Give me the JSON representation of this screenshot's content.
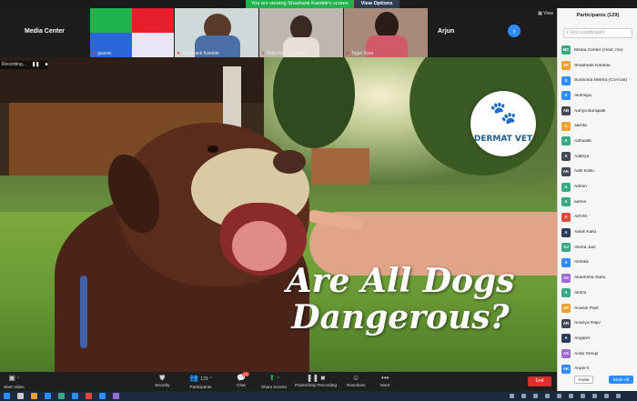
{
  "banner": {
    "message": "You are viewing Shashank Kamble's screen",
    "view_options": "View Options"
  },
  "strip": {
    "center_label": "Media Center",
    "right_label": "Arjun",
    "view_label": "View",
    "thumbs": [
      {
        "name": "gaurav"
      },
      {
        "name": "Shashank Kamble"
      },
      {
        "name": "Ruhi-Precious Pawi"
      },
      {
        "name": "Tejas Vyas"
      }
    ]
  },
  "video": {
    "headline_line1": "Are All Dogs",
    "headline_line2": "Dangerous?",
    "logo_text": "DERMAT VET",
    "rec_status": "Recording..."
  },
  "toolbar": {
    "start_video": "Start Video",
    "security": "Security",
    "participants": "Participants",
    "participant_count": "129",
    "chat": "Chat",
    "chat_badge": "10",
    "share_screen": "Share Screen",
    "recording": "Pause/Stop Recording",
    "reactions": "Reactions",
    "more": "More",
    "end": "End"
  },
  "panel": {
    "title": "Participants (129)",
    "search_placeholder": "Find a participant",
    "invite": "Invite",
    "mute_all": "Mute All",
    "participants": [
      {
        "initials": "MC",
        "name": "Media Center (Host, me)",
        "color": "#3aa981"
      },
      {
        "initials": "SK",
        "name": "Shashank Kamble",
        "color": "#f0a030"
      },
      {
        "initials": "S",
        "name": "Sushmita Mishra (Co-host)",
        "color": "#2d8cff"
      },
      {
        "initials": "A",
        "name": "Akshaya",
        "color": "#2d8cff"
      },
      {
        "initials": "AB",
        "name": "Aanya Borapalli",
        "color": "#444a55"
      },
      {
        "initials": "A",
        "name": "aarrita",
        "color": "#f0a030"
      },
      {
        "initials": "A",
        "name": "Adhvaith",
        "color": "#3aa981"
      },
      {
        "initials": "A",
        "name": "Adithya",
        "color": "#444a55"
      },
      {
        "initials": "AK",
        "name": "Aditi Kallu",
        "color": "#444a55"
      },
      {
        "initials": "A",
        "name": "Admin",
        "color": "#3aa981"
      },
      {
        "initials": "A",
        "name": "admin",
        "color": "#3aa981"
      },
      {
        "initials": "A",
        "name": "ADVIK",
        "color": "#e5483a"
      },
      {
        "initials": "A",
        "name": "Advik Kallu",
        "color": "#2b3b5a"
      },
      {
        "initials": "AJ",
        "name": "Alisha Jain",
        "color": "#3aa981"
      },
      {
        "initials": "A",
        "name": "Alshika",
        "color": "#2d8cff"
      },
      {
        "initials": "AS",
        "name": "Akanksha Sahu",
        "color": "#9b6ad6"
      },
      {
        "initials": "A",
        "name": "Akshit",
        "color": "#3aa981"
      },
      {
        "initials": "AP",
        "name": "Anandi Pant",
        "color": "#f0a030"
      },
      {
        "initials": "AR",
        "name": "Ananya Rajiv",
        "color": "#444a55"
      },
      {
        "initials": "A",
        "name": "Angaret",
        "color": "#2b3b5a"
      },
      {
        "initials": "AS",
        "name": "Anita Sreejit",
        "color": "#9b6ad6"
      },
      {
        "initials": "AK",
        "name": "Anjali K",
        "color": "#2d8cff"
      }
    ]
  }
}
